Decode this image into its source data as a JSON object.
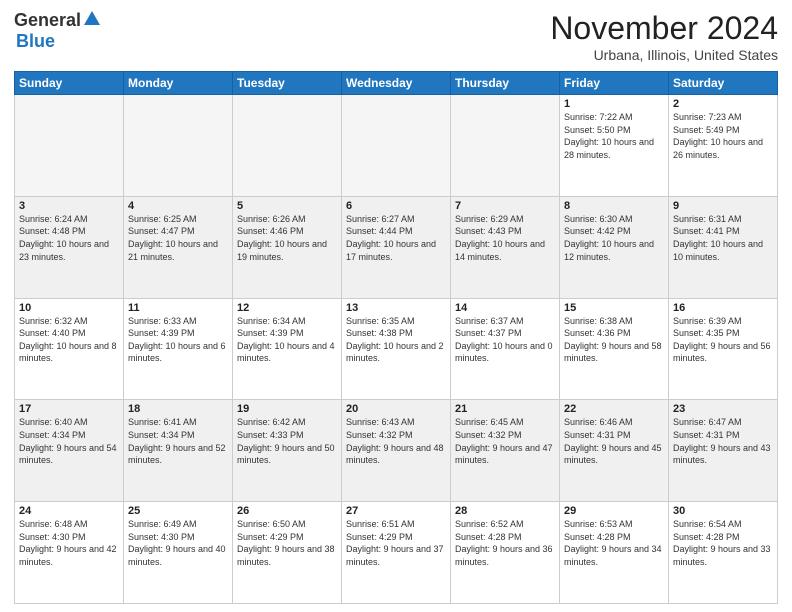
{
  "logo": {
    "general": "General",
    "blue": "Blue"
  },
  "title": "November 2024",
  "location": "Urbana, Illinois, United States",
  "days_of_week": [
    "Sunday",
    "Monday",
    "Tuesday",
    "Wednesday",
    "Thursday",
    "Friday",
    "Saturday"
  ],
  "weeks": [
    [
      {
        "day": "",
        "empty": true
      },
      {
        "day": "",
        "empty": true
      },
      {
        "day": "",
        "empty": true
      },
      {
        "day": "",
        "empty": true
      },
      {
        "day": "",
        "empty": true
      },
      {
        "day": "1",
        "sunrise": "Sunrise: 7:22 AM",
        "sunset": "Sunset: 5:50 PM",
        "daylight": "Daylight: 10 hours and 28 minutes."
      },
      {
        "day": "2",
        "sunrise": "Sunrise: 7:23 AM",
        "sunset": "Sunset: 5:49 PM",
        "daylight": "Daylight: 10 hours and 26 minutes."
      }
    ],
    [
      {
        "day": "3",
        "sunrise": "Sunrise: 6:24 AM",
        "sunset": "Sunset: 4:48 PM",
        "daylight": "Daylight: 10 hours and 23 minutes."
      },
      {
        "day": "4",
        "sunrise": "Sunrise: 6:25 AM",
        "sunset": "Sunset: 4:47 PM",
        "daylight": "Daylight: 10 hours and 21 minutes."
      },
      {
        "day": "5",
        "sunrise": "Sunrise: 6:26 AM",
        "sunset": "Sunset: 4:46 PM",
        "daylight": "Daylight: 10 hours and 19 minutes."
      },
      {
        "day": "6",
        "sunrise": "Sunrise: 6:27 AM",
        "sunset": "Sunset: 4:44 PM",
        "daylight": "Daylight: 10 hours and 17 minutes."
      },
      {
        "day": "7",
        "sunrise": "Sunrise: 6:29 AM",
        "sunset": "Sunset: 4:43 PM",
        "daylight": "Daylight: 10 hours and 14 minutes."
      },
      {
        "day": "8",
        "sunrise": "Sunrise: 6:30 AM",
        "sunset": "Sunset: 4:42 PM",
        "daylight": "Daylight: 10 hours and 12 minutes."
      },
      {
        "day": "9",
        "sunrise": "Sunrise: 6:31 AM",
        "sunset": "Sunset: 4:41 PM",
        "daylight": "Daylight: 10 hours and 10 minutes."
      }
    ],
    [
      {
        "day": "10",
        "sunrise": "Sunrise: 6:32 AM",
        "sunset": "Sunset: 4:40 PM",
        "daylight": "Daylight: 10 hours and 8 minutes."
      },
      {
        "day": "11",
        "sunrise": "Sunrise: 6:33 AM",
        "sunset": "Sunset: 4:39 PM",
        "daylight": "Daylight: 10 hours and 6 minutes."
      },
      {
        "day": "12",
        "sunrise": "Sunrise: 6:34 AM",
        "sunset": "Sunset: 4:39 PM",
        "daylight": "Daylight: 10 hours and 4 minutes."
      },
      {
        "day": "13",
        "sunrise": "Sunrise: 6:35 AM",
        "sunset": "Sunset: 4:38 PM",
        "daylight": "Daylight: 10 hours and 2 minutes."
      },
      {
        "day": "14",
        "sunrise": "Sunrise: 6:37 AM",
        "sunset": "Sunset: 4:37 PM",
        "daylight": "Daylight: 10 hours and 0 minutes."
      },
      {
        "day": "15",
        "sunrise": "Sunrise: 6:38 AM",
        "sunset": "Sunset: 4:36 PM",
        "daylight": "Daylight: 9 hours and 58 minutes."
      },
      {
        "day": "16",
        "sunrise": "Sunrise: 6:39 AM",
        "sunset": "Sunset: 4:35 PM",
        "daylight": "Daylight: 9 hours and 56 minutes."
      }
    ],
    [
      {
        "day": "17",
        "sunrise": "Sunrise: 6:40 AM",
        "sunset": "Sunset: 4:34 PM",
        "daylight": "Daylight: 9 hours and 54 minutes."
      },
      {
        "day": "18",
        "sunrise": "Sunrise: 6:41 AM",
        "sunset": "Sunset: 4:34 PM",
        "daylight": "Daylight: 9 hours and 52 minutes."
      },
      {
        "day": "19",
        "sunrise": "Sunrise: 6:42 AM",
        "sunset": "Sunset: 4:33 PM",
        "daylight": "Daylight: 9 hours and 50 minutes."
      },
      {
        "day": "20",
        "sunrise": "Sunrise: 6:43 AM",
        "sunset": "Sunset: 4:32 PM",
        "daylight": "Daylight: 9 hours and 48 minutes."
      },
      {
        "day": "21",
        "sunrise": "Sunrise: 6:45 AM",
        "sunset": "Sunset: 4:32 PM",
        "daylight": "Daylight: 9 hours and 47 minutes."
      },
      {
        "day": "22",
        "sunrise": "Sunrise: 6:46 AM",
        "sunset": "Sunset: 4:31 PM",
        "daylight": "Daylight: 9 hours and 45 minutes."
      },
      {
        "day": "23",
        "sunrise": "Sunrise: 6:47 AM",
        "sunset": "Sunset: 4:31 PM",
        "daylight": "Daylight: 9 hours and 43 minutes."
      }
    ],
    [
      {
        "day": "24",
        "sunrise": "Sunrise: 6:48 AM",
        "sunset": "Sunset: 4:30 PM",
        "daylight": "Daylight: 9 hours and 42 minutes."
      },
      {
        "day": "25",
        "sunrise": "Sunrise: 6:49 AM",
        "sunset": "Sunset: 4:30 PM",
        "daylight": "Daylight: 9 hours and 40 minutes."
      },
      {
        "day": "26",
        "sunrise": "Sunrise: 6:50 AM",
        "sunset": "Sunset: 4:29 PM",
        "daylight": "Daylight: 9 hours and 38 minutes."
      },
      {
        "day": "27",
        "sunrise": "Sunrise: 6:51 AM",
        "sunset": "Sunset: 4:29 PM",
        "daylight": "Daylight: 9 hours and 37 minutes."
      },
      {
        "day": "28",
        "sunrise": "Sunrise: 6:52 AM",
        "sunset": "Sunset: 4:28 PM",
        "daylight": "Daylight: 9 hours and 36 minutes."
      },
      {
        "day": "29",
        "sunrise": "Sunrise: 6:53 AM",
        "sunset": "Sunset: 4:28 PM",
        "daylight": "Daylight: 9 hours and 34 minutes."
      },
      {
        "day": "30",
        "sunrise": "Sunrise: 6:54 AM",
        "sunset": "Sunset: 4:28 PM",
        "daylight": "Daylight: 9 hours and 33 minutes."
      }
    ]
  ]
}
